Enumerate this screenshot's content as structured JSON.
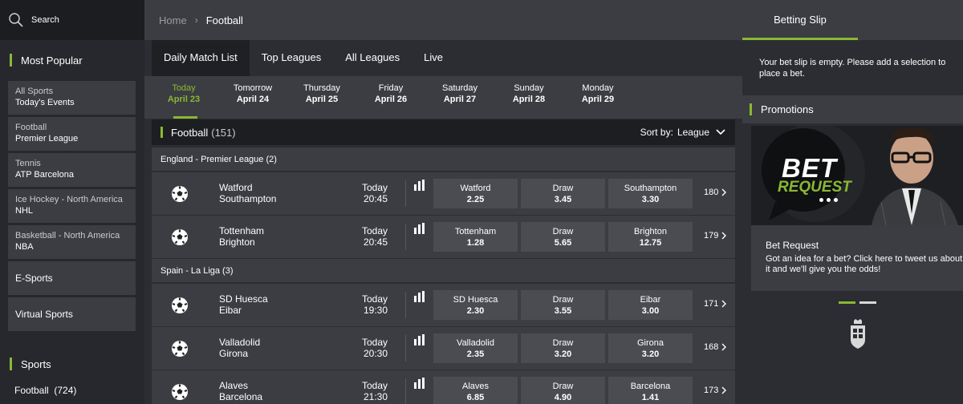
{
  "search": {
    "label": "Search"
  },
  "sidebar": {
    "most_popular_title": "Most Popular",
    "items": [
      {
        "line1": "All Sports",
        "line2": "Today's Events"
      },
      {
        "line1": "Football",
        "line2": "Premier League"
      },
      {
        "line1": "Tennis",
        "line2": "ATP Barcelona"
      },
      {
        "line1": "Ice Hockey - North America",
        "line2": "NHL"
      },
      {
        "line1": "Basketball - North America",
        "line2": "NBA"
      },
      {
        "line1": "E-Sports"
      },
      {
        "line1": "Virtual Sports"
      }
    ],
    "sports_title": "Sports",
    "football_entry": "Football  (724)"
  },
  "breadcrumb": {
    "home": "Home",
    "separator": "›",
    "current": "Football"
  },
  "tabs": [
    "Daily Match List",
    "Top Leagues",
    "All Leagues",
    "Live"
  ],
  "days": [
    {
      "name": "Today",
      "date": "April 23"
    },
    {
      "name": "Tomorrow",
      "date": "April 24"
    },
    {
      "name": "Thursday",
      "date": "April 25"
    },
    {
      "name": "Friday",
      "date": "April 26"
    },
    {
      "name": "Saturday",
      "date": "April 27"
    },
    {
      "name": "Sunday",
      "date": "April 28"
    },
    {
      "name": "Monday",
      "date": "April 29"
    }
  ],
  "football_header": {
    "title": "Football",
    "count": "(151)",
    "sort_label": "Sort by:",
    "sort_value": "League"
  },
  "leagues": [
    {
      "title": "England - Premier League  (2)",
      "matches": [
        {
          "home": "Watford",
          "away": "Southampton",
          "day": "Today",
          "time": "20:45",
          "odds": [
            {
              "name": "Watford",
              "value": "2.25"
            },
            {
              "name": "Draw",
              "value": "3.45"
            },
            {
              "name": "Southampton",
              "value": "3.30"
            }
          ],
          "more": "180"
        },
        {
          "home": "Tottenham",
          "away": "Brighton",
          "day": "Today",
          "time": "20:45",
          "odds": [
            {
              "name": "Tottenham",
              "value": "1.28"
            },
            {
              "name": "Draw",
              "value": "5.65"
            },
            {
              "name": "Brighton",
              "value": "12.75"
            }
          ],
          "more": "179"
        }
      ]
    },
    {
      "title": "Spain - La Liga  (3)",
      "matches": [
        {
          "home": "SD Huesca",
          "away": "Eibar",
          "day": "Today",
          "time": "19:30",
          "odds": [
            {
              "name": "SD Huesca",
              "value": "2.30"
            },
            {
              "name": "Draw",
              "value": "3.55"
            },
            {
              "name": "Eibar",
              "value": "3.00"
            }
          ],
          "more": "171"
        },
        {
          "home": "Valladolid",
          "away": "Girona",
          "day": "Today",
          "time": "20:30",
          "odds": [
            {
              "name": "Valladolid",
              "value": "2.35"
            },
            {
              "name": "Draw",
              "value": "3.20"
            },
            {
              "name": "Girona",
              "value": "3.20"
            }
          ],
          "more": "168"
        },
        {
          "home": "Alaves",
          "away": "Barcelona",
          "day": "Today",
          "time": "21:30",
          "odds": [
            {
              "name": "Alaves",
              "value": "6.85"
            },
            {
              "name": "Draw",
              "value": "4.90"
            },
            {
              "name": "Barcelona",
              "value": "1.41"
            }
          ],
          "more": "173"
        }
      ]
    }
  ],
  "betslip": {
    "title": "Betting Slip",
    "empty_message": "Your bet slip is empty. Please add a selection to place a bet."
  },
  "promotions": {
    "title": "Promotions",
    "banner_line1": "BET",
    "banner_line2": "REQUEST",
    "card_title": "Bet Request",
    "card_desc": "Got an idea for a bet? Click here to tweet us about it and we'll give you the odds!"
  },
  "colors": {
    "accent": "#8ab833",
    "panel": "#3b3d43",
    "background": "#2b2d32"
  }
}
